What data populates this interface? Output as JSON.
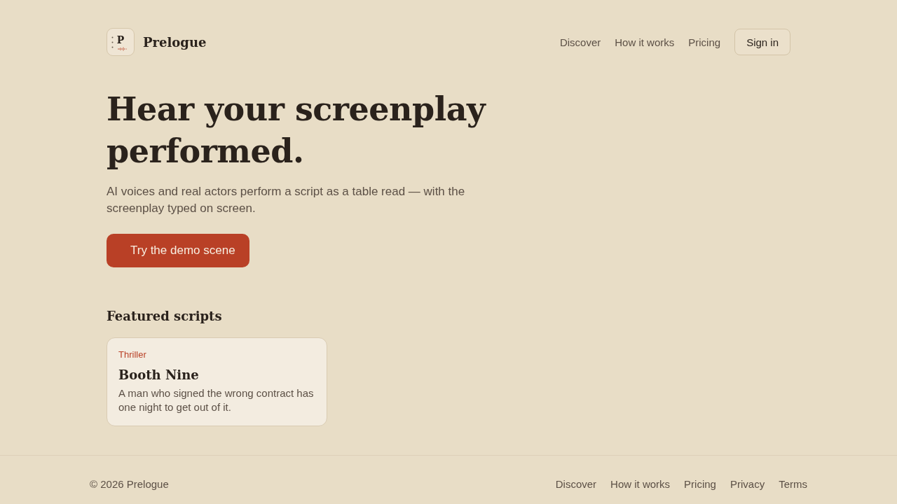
{
  "header": {
    "logo": {
      "letter": "P",
      "name": "Prelogue"
    },
    "nav": [
      "Discover",
      "How it works",
      "Pricing"
    ],
    "sign_in": "Sign in"
  },
  "hero": {
    "title": "Hear your screenplay performed.",
    "subtitle": "AI voices and real actors perform a script as a table read — with the screenplay typed on screen.",
    "cta": "Try the demo scene"
  },
  "featured": {
    "heading": "Featured scripts",
    "scripts": [
      {
        "genre": "Thriller",
        "title": "Booth Nine",
        "logline": "A man who signed the wrong contract has one night to get out of it."
      }
    ]
  },
  "footer": {
    "copyright": "© 2026 Prelogue",
    "links": [
      "Discover",
      "How it works",
      "Pricing",
      "Privacy",
      "Terms"
    ]
  }
}
